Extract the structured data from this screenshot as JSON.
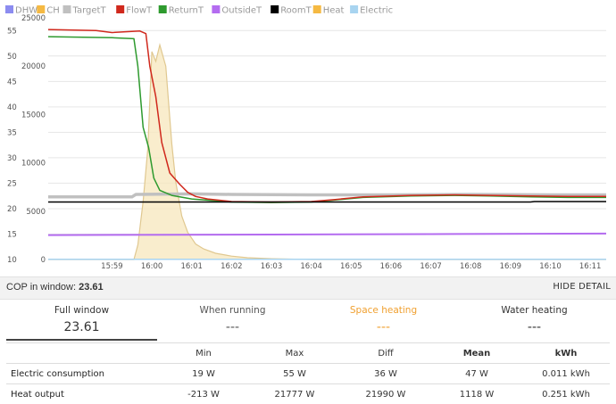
{
  "legend": [
    {
      "name": "DHW",
      "color": "#8c8cf0"
    },
    {
      "name": "CH",
      "color": "#f5b942"
    },
    {
      "name": "TargetT",
      "color": "#c0c0c0"
    },
    {
      "name": "FlowT",
      "color": "#d0281c"
    },
    {
      "name": "ReturnT",
      "color": "#2e9a2e"
    },
    {
      "name": "OutsideT",
      "color": "#b46cf0"
    },
    {
      "name": "RoomT",
      "color": "#000000"
    },
    {
      "name": "Heat",
      "color": "#f5b942"
    },
    {
      "name": "Electric",
      "color": "#a8d4f0"
    }
  ],
  "chart_data": {
    "type": "line",
    "x_tick_labels": [
      "15:59",
      "16:00",
      "16:01",
      "16:02",
      "16:03",
      "16:04",
      "16:05",
      "16:06",
      "16:07",
      "16:08",
      "16:09",
      "16:10",
      "16:11"
    ],
    "y_left_ticks": [
      10,
      15,
      20,
      25,
      30,
      35,
      40,
      45,
      50,
      55
    ],
    "y_left_range": [
      10,
      57.5
    ],
    "y_right_ticks": [
      0,
      5000,
      10000,
      15000,
      20000,
      25000
    ],
    "y_right_range": [
      0,
      25000
    ],
    "x_range_minutes": [
      -1.6,
      12.4
    ],
    "series": [
      {
        "name": "FlowT",
        "axis": "left",
        "color": "#d0281c",
        "points": [
          [
            -1.6,
            55.2
          ],
          [
            -0.4,
            55
          ],
          [
            0,
            54.6
          ],
          [
            0.7,
            54.9
          ],
          [
            0.85,
            54.4
          ],
          [
            0.95,
            48
          ],
          [
            1.1,
            42
          ],
          [
            1.25,
            33
          ],
          [
            1.45,
            27
          ],
          [
            1.7,
            24.8
          ],
          [
            1.9,
            23.2
          ],
          [
            2.1,
            22.4
          ],
          [
            2.4,
            21.9
          ],
          [
            3,
            21.4
          ],
          [
            4,
            21.3
          ],
          [
            5,
            21.4
          ],
          [
            5.6,
            21.8
          ],
          [
            6.3,
            22.3
          ],
          [
            7.5,
            22.6
          ],
          [
            8.6,
            22.7
          ],
          [
            9.5,
            22.6
          ],
          [
            10.5,
            22.5
          ],
          [
            11.5,
            22.4
          ],
          [
            12.4,
            22.4
          ]
        ]
      },
      {
        "name": "ReturnT",
        "axis": "left",
        "color": "#2e9a2e",
        "points": [
          [
            -1.6,
            53.8
          ],
          [
            0,
            53.6
          ],
          [
            0.55,
            53.4
          ],
          [
            0.65,
            48
          ],
          [
            0.78,
            36
          ],
          [
            0.92,
            32
          ],
          [
            1.05,
            26
          ],
          [
            1.2,
            23.6
          ],
          [
            1.5,
            22.6
          ],
          [
            2,
            21.9
          ],
          [
            3,
            21.3
          ],
          [
            4,
            21.2
          ],
          [
            5,
            21.3
          ],
          [
            5.6,
            21.7
          ],
          [
            6.3,
            22.2
          ],
          [
            7.5,
            22.5
          ],
          [
            8.6,
            22.6
          ],
          [
            9.5,
            22.5
          ],
          [
            10.5,
            22.3
          ],
          [
            11.5,
            22.2
          ],
          [
            12.4,
            22.2
          ]
        ]
      },
      {
        "name": "TargetT",
        "axis": "left",
        "color": "#c0c0c0",
        "points": [
          [
            -1.6,
            22.3
          ],
          [
            0.5,
            22.3
          ],
          [
            0.6,
            22.8
          ],
          [
            2,
            22.9
          ],
          [
            3,
            22.8
          ],
          [
            5,
            22.7
          ],
          [
            7,
            22.7
          ],
          [
            9,
            22.8
          ],
          [
            11,
            22.7
          ],
          [
            12.4,
            22.7
          ]
        ]
      },
      {
        "name": "RoomT",
        "axis": "left",
        "color": "#000000",
        "points": [
          [
            -1.6,
            21.3
          ],
          [
            10.5,
            21.3
          ],
          [
            10.6,
            21.4
          ],
          [
            12.4,
            21.4
          ]
        ]
      },
      {
        "name": "OutsideT",
        "axis": "left",
        "color": "#b46cf0",
        "points": [
          [
            -1.6,
            14.8
          ],
          [
            4,
            14.9
          ],
          [
            8,
            15
          ],
          [
            12.4,
            15.1
          ]
        ]
      },
      {
        "name": "Heat",
        "axis": "right",
        "color": "#f5b942",
        "fill": true,
        "points": [
          [
            -1.6,
            0
          ],
          [
            0.55,
            0
          ],
          [
            0.65,
            1500
          ],
          [
            0.78,
            6000
          ],
          [
            0.9,
            11500
          ],
          [
            1.0,
            21500
          ],
          [
            1.1,
            20500
          ],
          [
            1.2,
            22200
          ],
          [
            1.35,
            20000
          ],
          [
            1.5,
            12000
          ],
          [
            1.6,
            8000
          ],
          [
            1.75,
            4500
          ],
          [
            1.9,
            2800
          ],
          [
            2.1,
            1600
          ],
          [
            2.3,
            1100
          ],
          [
            2.6,
            650
          ],
          [
            3,
            350
          ],
          [
            3.4,
            180
          ],
          [
            4,
            80
          ],
          [
            5,
            0
          ],
          [
            12.4,
            0
          ]
        ]
      },
      {
        "name": "Electric",
        "axis": "right",
        "color": "#a8d4f0",
        "points": [
          [
            -1.6,
            20
          ],
          [
            12.4,
            20
          ]
        ]
      }
    ]
  },
  "summary": {
    "label": "COP in window:",
    "value": "23.61",
    "hide_label": "HIDE DETAIL"
  },
  "tabs": [
    {
      "label": "Full window",
      "value": "23.61",
      "color": "#333333",
      "active": true
    },
    {
      "label": "When running",
      "value": "---",
      "color": "#555555",
      "active": false
    },
    {
      "label": "Space heating",
      "value": "---",
      "color": "#f0a030",
      "active": false
    },
    {
      "label": "Water heating",
      "value": "---",
      "color": "#333333",
      "active": false
    }
  ],
  "table": {
    "headers": [
      "",
      "Min",
      "Max",
      "Diff",
      "Mean",
      "kWh"
    ],
    "rows": [
      [
        "Electric consumption",
        "19 W",
        "55 W",
        "36 W",
        "47 W",
        "0.011 kWh"
      ],
      [
        "Heat output",
        "-213 W",
        "21777 W",
        "21990 W",
        "1118 W",
        "0.251 kWh"
      ]
    ]
  }
}
